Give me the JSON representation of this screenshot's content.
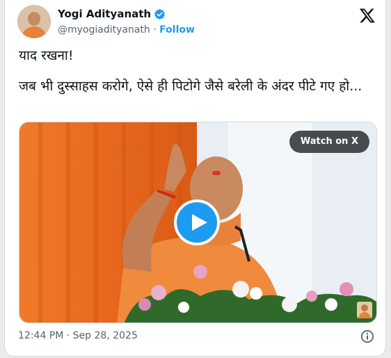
{
  "author": {
    "name": "Yogi Adityanath",
    "handle": "@myogiadityanath",
    "separator": " · ",
    "follow_label": "Follow",
    "verified_icon": "verified-badge-icon"
  },
  "tweet": {
    "text_line1": "याद रखना!",
    "text_body": "जब भी दुस्साहस करोगे, ऐसे ही पिटोगे जैसे बरेली के अंदर पीटे गए हो..."
  },
  "media": {
    "watch_label": "Watch on X",
    "play_icon": "play-icon"
  },
  "footer": {
    "timestamp": "12:44 PM · Sep 28, 2025",
    "info_icon": "info-icon"
  },
  "colors": {
    "accent": "#1d9bf0",
    "text": "#0f1419",
    "muted": "#536471",
    "saffron": "#e8843a"
  }
}
